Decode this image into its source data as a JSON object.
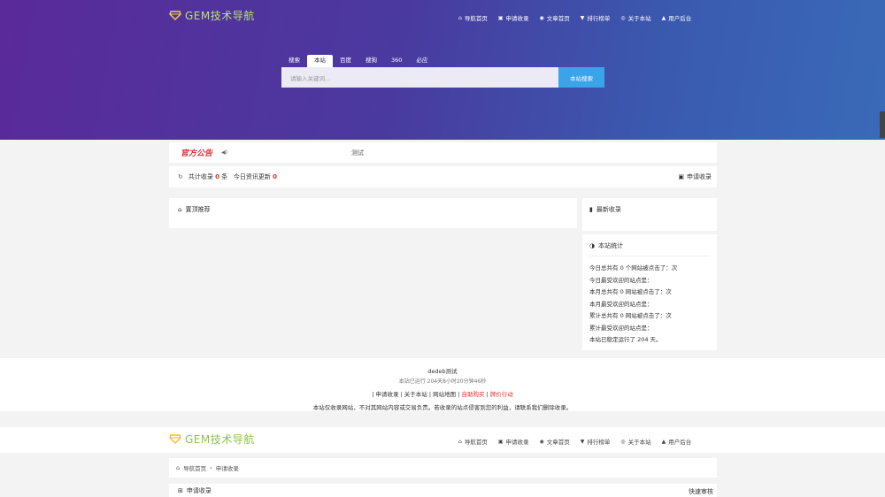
{
  "site": {
    "logo_text": "GEM技术导航",
    "logo_accent": "#b8e07a"
  },
  "nav": [
    {
      "icon": "home-icon",
      "glyph": "⌂",
      "label": "导航首页"
    },
    {
      "icon": "apply-icon",
      "glyph": "▣",
      "label": "申请收录"
    },
    {
      "icon": "article-icon",
      "glyph": "◉",
      "label": "文章首页"
    },
    {
      "icon": "rank-icon",
      "glyph": "▼",
      "label": "排行榜单"
    },
    {
      "icon": "info-icon",
      "glyph": "◎",
      "label": "关于本站"
    },
    {
      "icon": "user-icon",
      "glyph": "▲",
      "label": "用户后台"
    }
  ],
  "search": {
    "tabs": [
      "搜索",
      "本站",
      "百度",
      "搜狗",
      "360",
      "必应"
    ],
    "active_tab": 1,
    "placeholder": "请输入关键词...",
    "button": "本站搜索"
  },
  "notice": {
    "brand": "官方公告",
    "message": "测试"
  },
  "stats": {
    "total_label": "共计收录",
    "total": "0",
    "total_unit": "条",
    "today_label": "今日资讯更新",
    "today": "0",
    "apply": "申请收录"
  },
  "pinned": {
    "title": "置顶推荐"
  },
  "newly": {
    "title": "最新收录"
  },
  "sitestats": {
    "title": "本站统计",
    "lines": [
      "今日总共有 0 个网站被点击了：次",
      "今日最受欢迎的站点是：",
      "本月总共有 0 网站被点击了：次",
      "本月最受欢迎的站点是：",
      "累计总共有 0 网站被点击了：次",
      "累计最受欢迎的站点是：",
      "本站已稳定运行了 204 天。"
    ]
  },
  "footer": {
    "line1": "dedeb测试",
    "line2": "本站已运行 204天8小时20分钟46秒",
    "links": [
      "申请收录",
      "关于本站",
      "网站地图",
      "自助购买",
      "牌价行动"
    ],
    "disclaimer": "本站仅收录网站，不对其网站内容或交易负责。若收录的站点侵害到您的利益，请联系我们删除收录。"
  },
  "page2": {
    "crumb_home": "导航首页",
    "crumb_current": "申请收录",
    "apply_title": "申请收录",
    "quick_review": "快速审核"
  }
}
